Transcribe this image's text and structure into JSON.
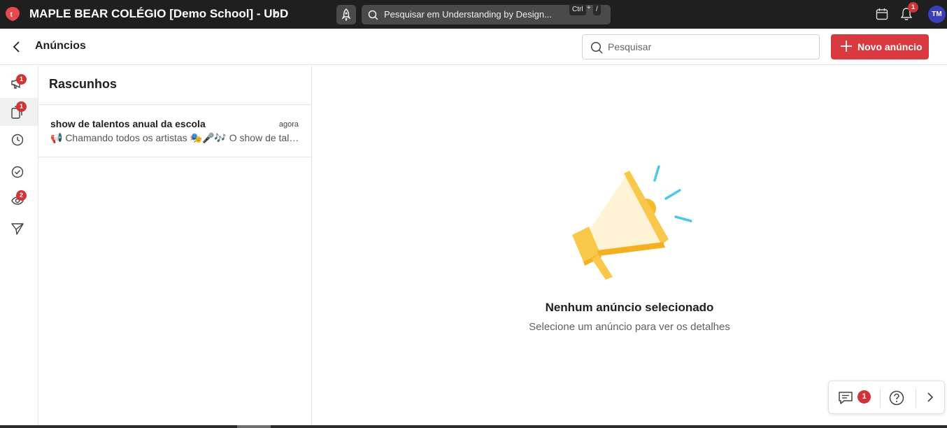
{
  "topbar": {
    "school_title": "MAPLE BEAR COLÉGIO [Demo School] - UbD",
    "search_placeholder": "Pesquisar em Understanding by Design...",
    "shortcut_ctrl": "Ctrl",
    "shortcut_plus": "+",
    "shortcut_slash": "/",
    "notifications_count": "1",
    "avatar_initials": "TM"
  },
  "header": {
    "page_title": "Anúncios",
    "search_placeholder": "Pesquisar",
    "new_button_label": "Novo anúncio"
  },
  "rail": {
    "items": [
      {
        "icon": "megaphone-icon",
        "badge": "1"
      },
      {
        "icon": "draft-icon",
        "badge": "1",
        "active": true
      },
      {
        "icon": "clock-icon",
        "badge": ""
      },
      {
        "icon": "check-circle-icon",
        "badge": ""
      },
      {
        "icon": "eye-icon",
        "badge": "2"
      },
      {
        "icon": "send-icon",
        "badge": ""
      }
    ]
  },
  "drafts": {
    "title": "Rascunhos",
    "items": [
      {
        "name": "show de talentos anual da escola",
        "time": "agora",
        "preview": "📢 Chamando todos os artistas 🎭🎤🎶 O show de talentos anual da escola está chegando"
      }
    ]
  },
  "empty_state": {
    "title": "Nenhum anúncio selecionado",
    "subtitle": "Selecione um anúncio para ver os detalhes"
  },
  "helper": {
    "chat_badge": "1"
  },
  "colors": {
    "accent": "#d93a3f",
    "topbar": "#1f1f1f",
    "badge": "#d13438",
    "avatar": "#3b3fb8"
  }
}
